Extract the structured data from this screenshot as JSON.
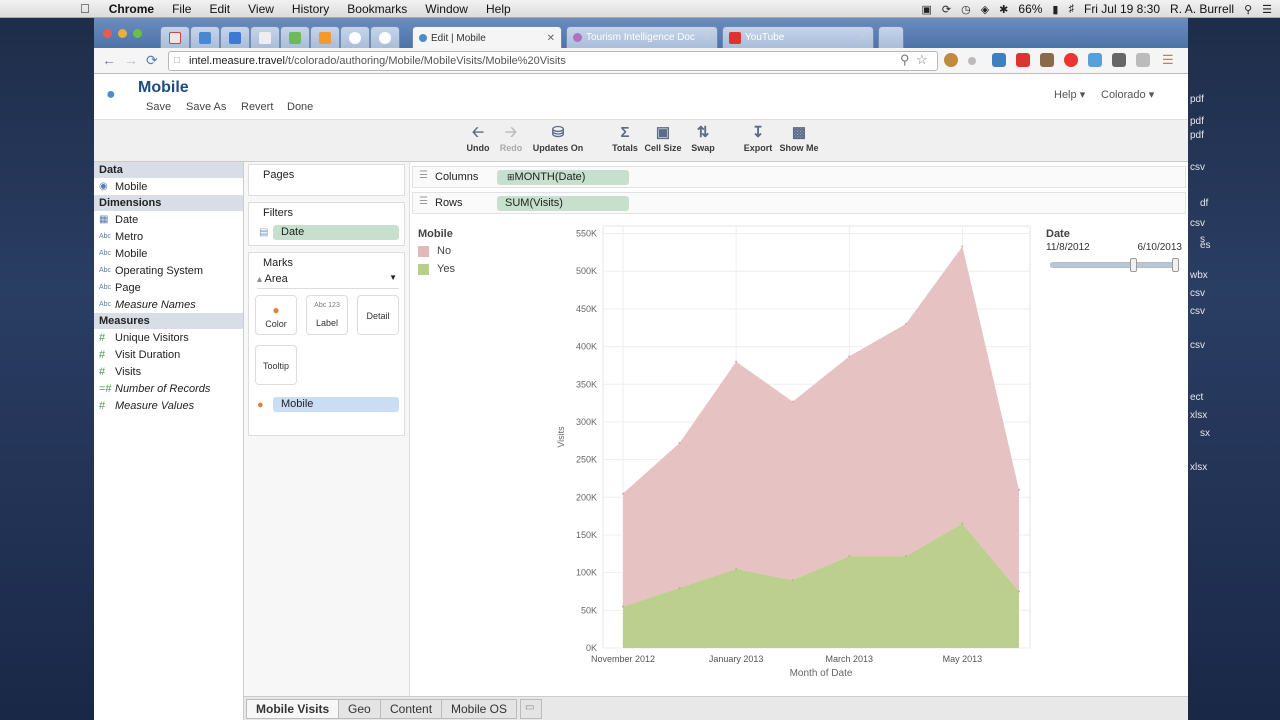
{
  "menubar": {
    "apple_icon": "apple-icon",
    "items": [
      "Chrome",
      "File",
      "Edit",
      "View",
      "History",
      "Bookmarks",
      "Window",
      "Help"
    ],
    "battery": "66%",
    "datetime": "Fri Jul 19  8:30",
    "user": "R. A. Burrell"
  },
  "browser": {
    "tabs": [
      {
        "label": "Edit | Mobile",
        "active": true
      },
      {
        "label": "Tourism Intelligence Doc",
        "active": false
      },
      {
        "label": "YouTube",
        "active": false
      }
    ],
    "url_host": "intel.measure.travel",
    "url_path": "/t/colorado/authoring/Mobile/MobileVisits/Mobile%20Visits"
  },
  "app": {
    "title": "Mobile",
    "header_links": [
      "Save",
      "Save As",
      "Revert",
      "Done"
    ],
    "help": "Help",
    "site": "Colorado",
    "toolbar": [
      {
        "label": "Undo",
        "icon": "undo-icon",
        "enabled": true
      },
      {
        "label": "Redo",
        "icon": "redo-icon",
        "enabled": false
      },
      {
        "label": "Updates On",
        "icon": "updates-icon",
        "enabled": true
      },
      {
        "label": "Totals",
        "icon": "sigma-icon",
        "enabled": true
      },
      {
        "label": "Cell Size",
        "icon": "cell-size-icon",
        "enabled": true
      },
      {
        "label": "Swap",
        "icon": "swap-icon",
        "enabled": true
      },
      {
        "label": "Export",
        "icon": "export-icon",
        "enabled": true
      },
      {
        "label": "Show Me",
        "icon": "show-me-icon",
        "enabled": true
      }
    ]
  },
  "sidebar": {
    "data_header": "Data",
    "datasource": "Mobile",
    "dimensions_header": "Dimensions",
    "dimensions": [
      {
        "label": "Date",
        "type": "date",
        "italic": false
      },
      {
        "label": "Metro",
        "type": "Abc",
        "italic": false
      },
      {
        "label": "Mobile",
        "type": "Abc",
        "italic": false
      },
      {
        "label": "Operating System",
        "type": "Abc",
        "italic": false
      },
      {
        "label": "Page",
        "type": "Abc",
        "italic": false
      },
      {
        "label": "Measure Names",
        "type": "Abc",
        "italic": true
      }
    ],
    "measures_header": "Measures",
    "measures": [
      {
        "label": "Unique Visitors",
        "type": "#",
        "italic": false
      },
      {
        "label": "Visit Duration",
        "type": "#",
        "italic": false
      },
      {
        "label": "Visits",
        "type": "#",
        "italic": false
      },
      {
        "label": "Number of Records",
        "type": "=#",
        "italic": true
      },
      {
        "label": "Measure Values",
        "type": "#",
        "italic": true
      }
    ]
  },
  "shelves": {
    "pages_label": "Pages",
    "filters_label": "Filters",
    "filter_pill": "Date",
    "marks_label": "Marks",
    "mark_type": "Area",
    "mark_buttons": [
      "Color",
      "Label",
      "Detail",
      "Tooltip"
    ],
    "label_icon_text": "Abc 123",
    "color_pill": "Mobile",
    "columns_label": "Columns",
    "columns_pill": "MONTH(Date)",
    "rows_label": "Rows",
    "rows_pill": "SUM(Visits)"
  },
  "legend": {
    "title": "Mobile",
    "items": [
      {
        "label": "No",
        "color": "#e3b8b8"
      },
      {
        "label": "Yes",
        "color": "#b8cf8b"
      }
    ]
  },
  "date_filter": {
    "title": "Date",
    "start": "11/8/2012",
    "end": "6/10/2013",
    "range_fraction": [
      0.0,
      1.0
    ]
  },
  "chart_data": {
    "type": "area",
    "stacked": true,
    "x": [
      "Nov 2012",
      "Dec 2012",
      "Jan 2013",
      "Feb 2013",
      "Mar 2013",
      "Apr 2013",
      "May 2013",
      "Jun 2013"
    ],
    "series": [
      {
        "name": "Yes",
        "color": "#bccf8e",
        "values": [
          55000,
          80000,
          105000,
          90000,
          122000,
          122000,
          165000,
          75000
        ]
      },
      {
        "name": "No",
        "color": "#e7c2c2",
        "values": [
          150000,
          192000,
          275000,
          237000,
          265000,
          308000,
          368000,
          135000
        ]
      }
    ],
    "ylabel": "Visits",
    "xlabel": "Month of Date",
    "ylim": [
      0,
      560000
    ],
    "yticks": [
      "0K",
      "50K",
      "100K",
      "150K",
      "200K",
      "250K",
      "300K",
      "350K",
      "400K",
      "450K",
      "500K",
      "550K"
    ],
    "xtick_labels": [
      {
        "label": "November 2012",
        "index": 0
      },
      {
        "label": "January 2013",
        "index": 2
      },
      {
        "label": "March 2013",
        "index": 4
      },
      {
        "label": "May 2013",
        "index": 6
      }
    ],
    "grid": true
  },
  "bottom_tabs": [
    "Mobile Visits",
    "Geo",
    "Content",
    "Mobile OS"
  ],
  "desktop_files": [
    "pdf",
    "pdf",
    "pdf",
    "csv",
    "df",
    "csv",
    "s",
    "es",
    "wbx",
    "csv",
    "csv",
    "csv",
    "ect",
    "xlsx",
    "sx",
    "xlsx"
  ]
}
